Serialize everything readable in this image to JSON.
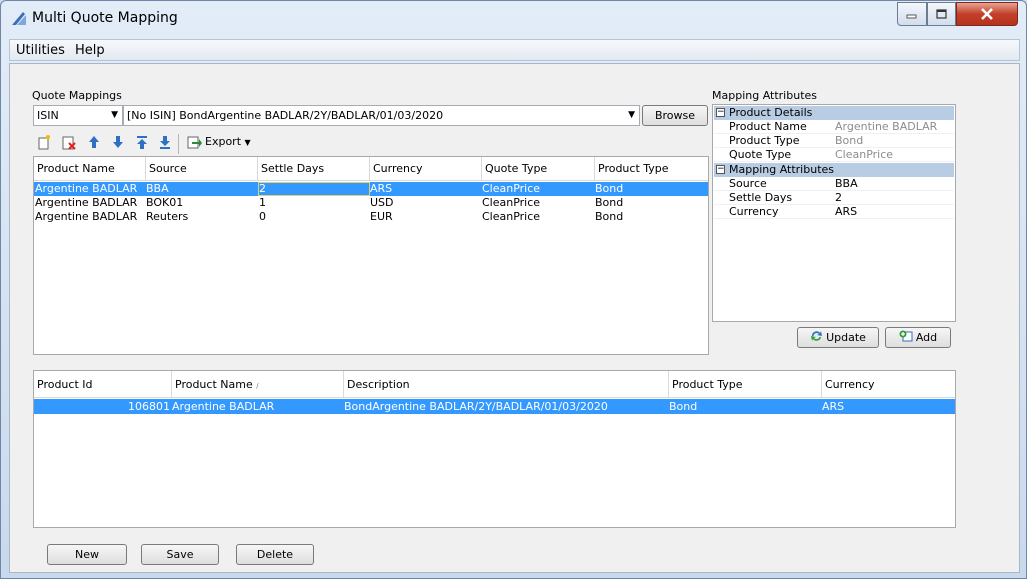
{
  "window": {
    "title": "Multi Quote Mapping"
  },
  "menu": {
    "items": [
      "Utilities",
      "Help"
    ]
  },
  "quote_mappings": {
    "section_label": "Quote Mappings",
    "id_type": "ISIN",
    "product_selector": "[No ISIN] BondArgentine BADLAR/2Y/BADLAR/01/03/2020",
    "browse_label": "Browse",
    "export_label": "Export",
    "columns": [
      "Product Name",
      "Source",
      "Settle Days",
      "Currency",
      "Quote Type",
      "Product Type"
    ],
    "rows": [
      [
        "Argentine BADLAR",
        "BBA",
        "2",
        "ARS",
        "CleanPrice",
        "Bond"
      ],
      [
        "Argentine BADLAR",
        "BOK01",
        "1",
        "USD",
        "CleanPrice",
        "Bond"
      ],
      [
        "Argentine BADLAR",
        "Reuters",
        "0",
        "EUR",
        "CleanPrice",
        "Bond"
      ]
    ]
  },
  "mapping_attributes": {
    "section_label": "Mapping Attributes",
    "groups": [
      {
        "name": "Product Details",
        "rows": [
          {
            "key": "Product Name",
            "value": "Argentine BADLAR"
          },
          {
            "key": "Product Type",
            "value": "Bond"
          },
          {
            "key": "Quote Type",
            "value": "CleanPrice"
          }
        ]
      },
      {
        "name": "Mapping Attributes",
        "rows": [
          {
            "key": "Source",
            "value": "BBA"
          },
          {
            "key": "Settle Days",
            "value": "2"
          },
          {
            "key": "Currency",
            "value": "ARS"
          }
        ]
      }
    ],
    "update_label": "Update",
    "add_label": "Add"
  },
  "products": {
    "columns": [
      "Product Id",
      "Product Name",
      "Description",
      "Product Type",
      "Currency"
    ],
    "sort_indicator": "∕",
    "rows": [
      [
        "106801",
        "Argentine BADLAR",
        "BondArgentine BADLAR/2Y/BADLAR/01/03/2020",
        "Bond",
        "ARS"
      ]
    ]
  },
  "footer": {
    "new_label": "New",
    "save_label": "Save",
    "delete_label": "Delete"
  },
  "colors": {
    "selection": "#3399ff",
    "group_header": "#b8cde4"
  }
}
